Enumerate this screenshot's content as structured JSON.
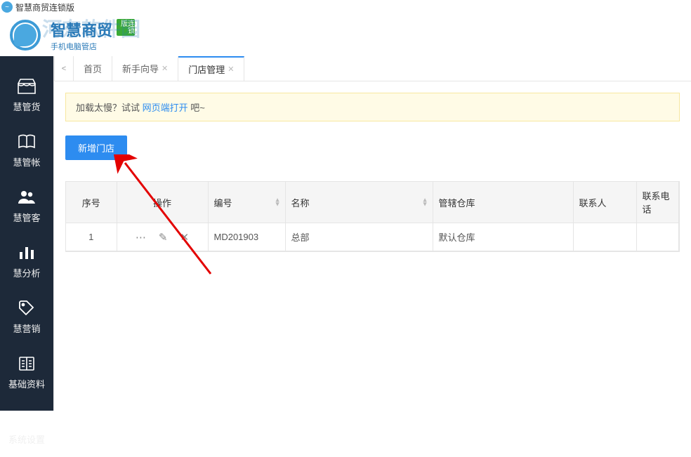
{
  "window": {
    "title": "智慧商贸连锁版"
  },
  "brand": {
    "name": "智慧商贸",
    "sub": "手机电脑管店",
    "watermark": "河东软件园",
    "badge": "连锁版"
  },
  "sidebar": {
    "items": [
      {
        "label": "慧管货"
      },
      {
        "label": "慧管帐"
      },
      {
        "label": "慧管客"
      },
      {
        "label": "慧分析"
      },
      {
        "label": "慧营销"
      },
      {
        "label": "基础资料"
      },
      {
        "label": "系统设置"
      }
    ]
  },
  "tabs": {
    "nav_prev": "<",
    "items": [
      {
        "label": "首页",
        "closable": false
      },
      {
        "label": "新手向导",
        "closable": true
      },
      {
        "label": "门店管理",
        "closable": true,
        "active": true
      }
    ]
  },
  "notice": {
    "prefix": "加载太慢？试试 ",
    "link": "网页端打开",
    "suffix": " 吧~"
  },
  "toolbar": {
    "add_store": "新增门店"
  },
  "table": {
    "headers": {
      "seq": "序号",
      "op": "操作",
      "code": "编号",
      "name": "名称",
      "warehouse": "管辖仓库",
      "contact": "联系人",
      "phone": "联系电话"
    },
    "rows": [
      {
        "seq": "1",
        "code": "MD201903",
        "name": "总部",
        "warehouse": "默认仓库",
        "contact": "",
        "phone": ""
      }
    ]
  }
}
